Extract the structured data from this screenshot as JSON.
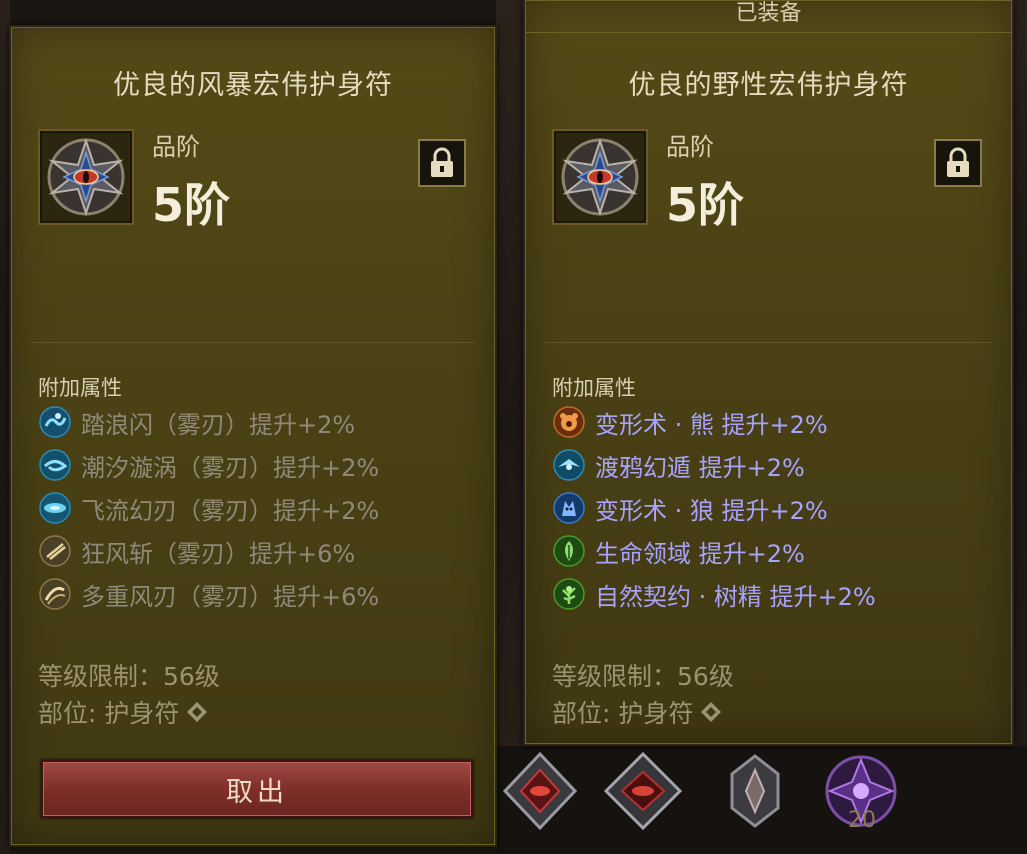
{
  "left_panel": {
    "title": "优良的风暴宏伟护身符",
    "grade_label": "品阶",
    "grade_value": "5阶",
    "section_label": "附加属性",
    "affixes": [
      {
        "text": "踏浪闪（雾刃）提升+2%",
        "icon": "wave-step-icon",
        "color": "#3fb0e0"
      },
      {
        "text": "潮汐漩涡（雾刃）提升+2%",
        "icon": "tide-vortex-icon",
        "color": "#3fb0e0"
      },
      {
        "text": "飞流幻刃（雾刃）提升+2%",
        "icon": "flying-blade-icon",
        "color": "#3fb0e0"
      },
      {
        "text": "狂风斩（雾刃）提升+6%",
        "icon": "gale-slash-icon",
        "color": "#c8b071"
      },
      {
        "text": "多重风刃（雾刃）提升+6%",
        "icon": "multi-wind-blade-icon",
        "color": "#c8b071"
      }
    ],
    "level_req": "等级限制：56级",
    "slot": "部位: 护身符",
    "take_button": "取出"
  },
  "right_panel": {
    "equipped_label": "已装备",
    "title": "优良的野性宏伟护身符",
    "grade_label": "品阶",
    "grade_value": "5阶",
    "section_label": "附加属性",
    "affixes": [
      {
        "text": "变形术 · 熊  提升+2%",
        "icon": "shapeshift-bear-icon",
        "color": "#e07a2f"
      },
      {
        "text": "渡鸦幻遁  提升+2%",
        "icon": "raven-escape-icon",
        "color": "#3fb0e0"
      },
      {
        "text": "变形术 · 狼  提升+2%",
        "icon": "shapeshift-wolf-icon",
        "color": "#4a8fe0"
      },
      {
        "text": "生命领域  提升+2%",
        "icon": "life-domain-icon",
        "color": "#5fc04a"
      },
      {
        "text": "自然契约 · 树精  提升+2%",
        "icon": "nature-pact-treant-icon",
        "color": "#5fc04a"
      }
    ],
    "level_req": "等级限制：56级",
    "slot": "部位: 护身符"
  },
  "bottom_slots": {
    "count": "20"
  },
  "colors": {
    "panel_bg": "#4d4315",
    "affix_inactive": "#8f8a78",
    "affix_active": "#a7a3ff",
    "button": "#8a3832"
  }
}
